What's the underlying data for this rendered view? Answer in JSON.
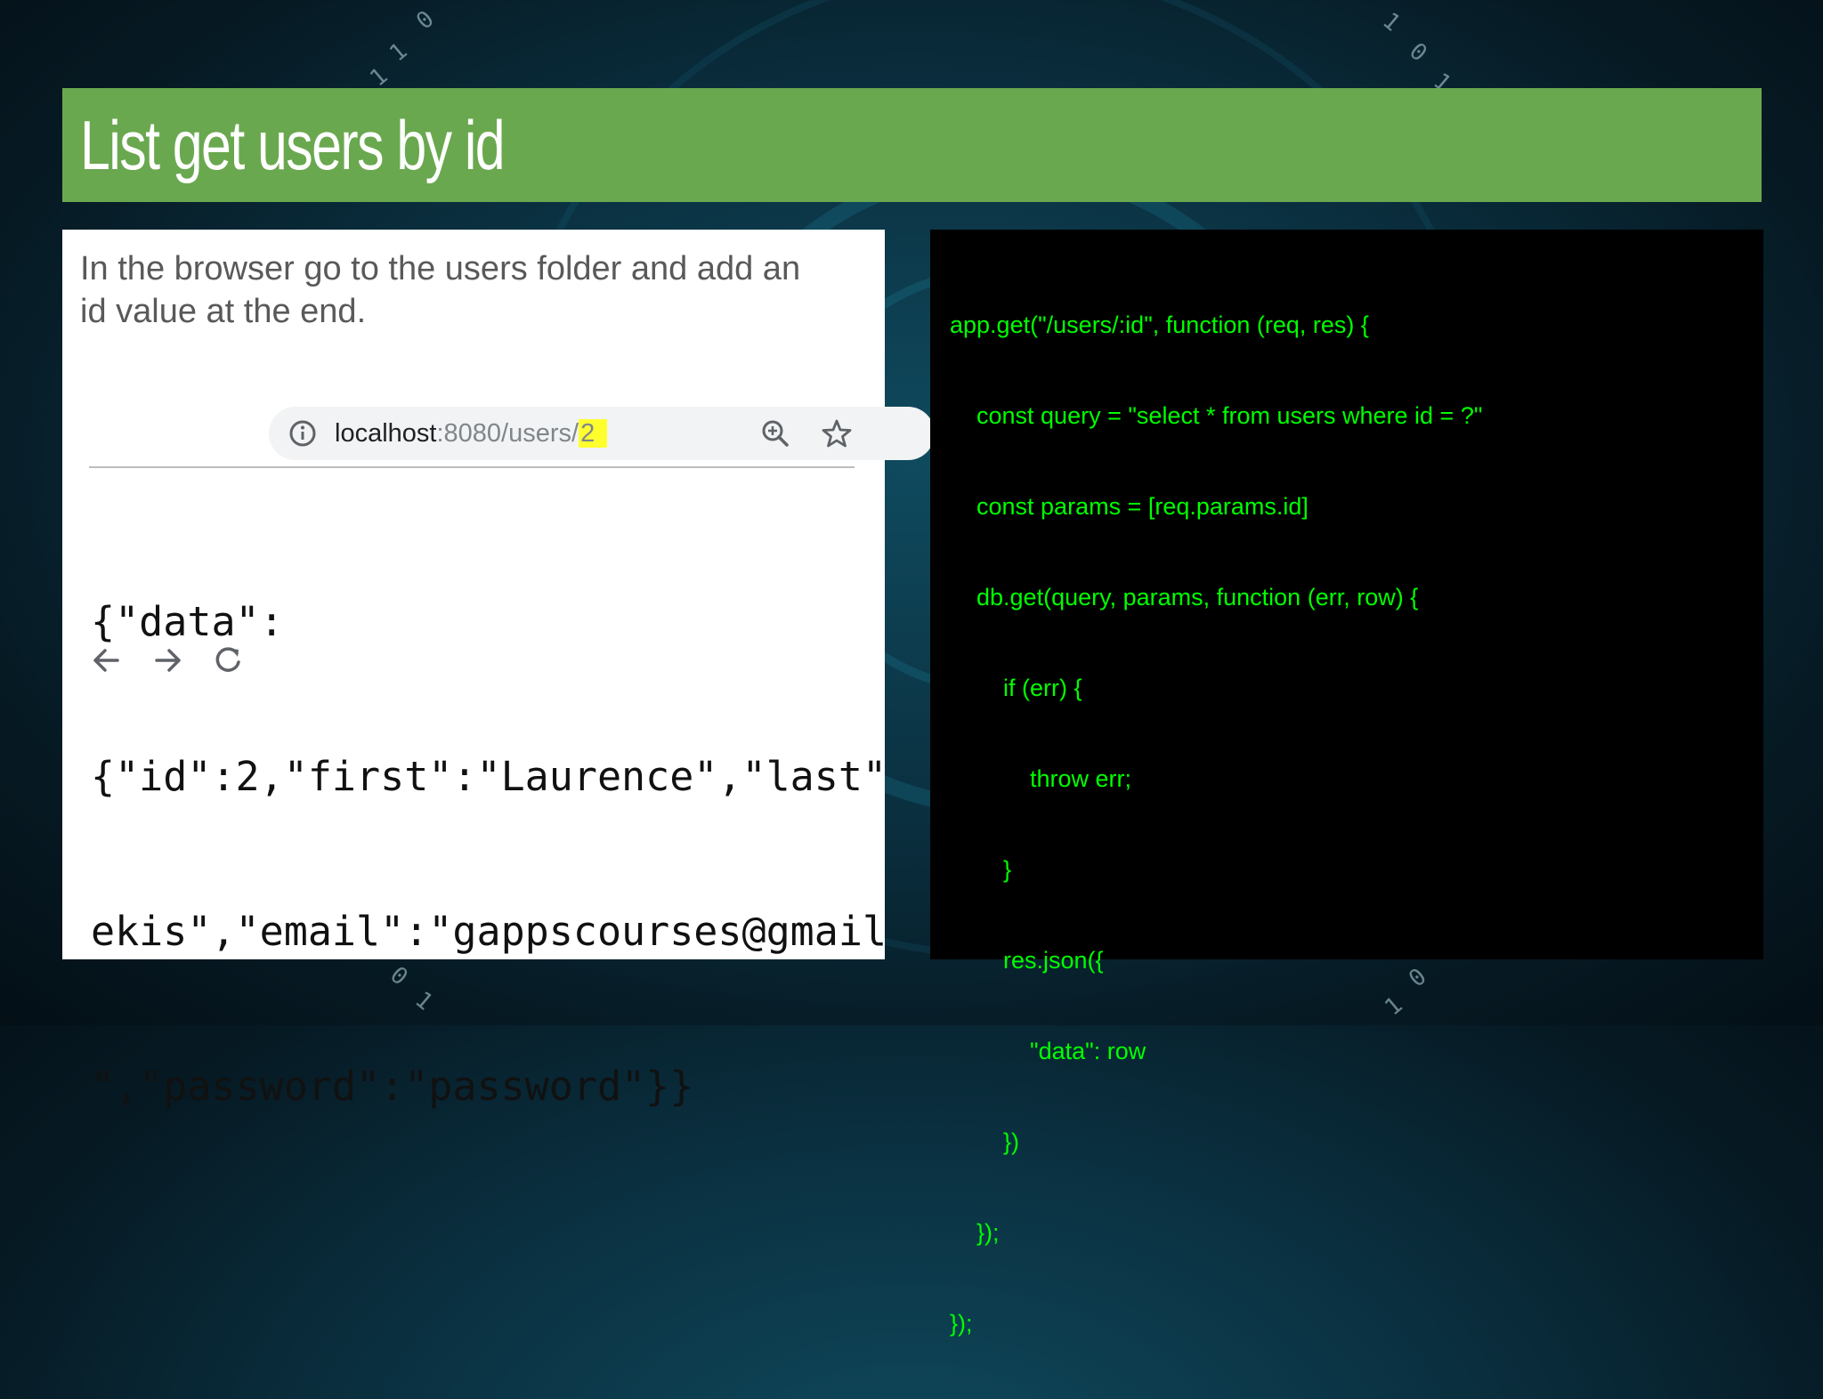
{
  "slide": {
    "title": "List get users by id",
    "instruction_lines": [
      "In the browser go to the users folder and add an",
      "id value at the end."
    ]
  },
  "browser": {
    "url_host": "localhost",
    "url_path": ":8080/users/",
    "url_highlight": "2",
    "highlight_color": "#ffff2e",
    "icons": [
      "back-arrow-icon",
      "forward-arrow-icon",
      "reload-icon",
      "info-icon",
      "zoom-icon",
      "star-icon"
    ],
    "response_lines": [
      "{\"data\":",
      "{\"id\":2,\"first\":\"Laurence\",\"last\"",
      "ekis\",\"email\":\"gappscourses@gmail",
      "\",\"password\":\"password\"}}"
    ]
  },
  "code_panel": {
    "text_color": "#00ff00",
    "lines": [
      "app.get(\"/users/:id\", function (req, res) {",
      "    const query = \"select * from users where id = ?\"",
      "    const params = [req.params.id]",
      "    db.get(query, params, function (err, row) {",
      "        if (err) {",
      "            throw err;",
      "        }",
      "        res.json({",
      "            \"data\": row",
      "        })",
      "    });",
      "});"
    ]
  },
  "colors": {
    "title_bar": "#6aa84f",
    "title_text": "#ffffff",
    "instruction_text": "#595959"
  }
}
